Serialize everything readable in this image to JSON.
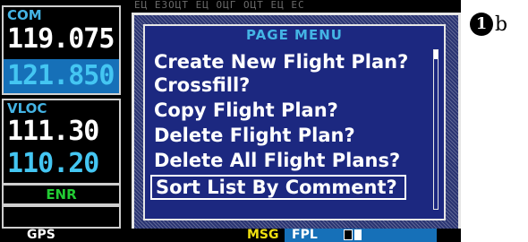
{
  "header": {
    "garbled_strip": "ЕЦ ЕЗОЦТ ЕЦ ОЦГ ОЦТ ЕЦ ЕС"
  },
  "com": {
    "tag": "COM",
    "active": "119.075",
    "standby": "121.850"
  },
  "vloc": {
    "tag": "VLOC",
    "active": "111.30",
    "standby": "110.20"
  },
  "status": {
    "enr": "ENR"
  },
  "page_menu": {
    "title": "PAGE MENU",
    "items": [
      {
        "label": "Create New Flight Plan?"
      },
      {
        "label": "Crossfill?"
      },
      {
        "label": "Copy Flight Plan?"
      },
      {
        "label": "Delete Flight Plan?"
      },
      {
        "label": "Delete All Flight Plans?"
      },
      {
        "label": "Sort List By Comment?"
      }
    ],
    "selected_index": 5
  },
  "bottom_bar": {
    "gps": "GPS",
    "msg": "MSG",
    "fpl": "FPL"
  },
  "callout": {
    "number": "1",
    "letter": "b"
  },
  "colors": {
    "tag_blue": "#44b4e4",
    "standby_cyan": "#44c6f2",
    "standby_bg": "#1670b8",
    "enr_green": "#22cc33",
    "msg_yellow": "#f0e010",
    "menu_bg": "#1c2880"
  }
}
